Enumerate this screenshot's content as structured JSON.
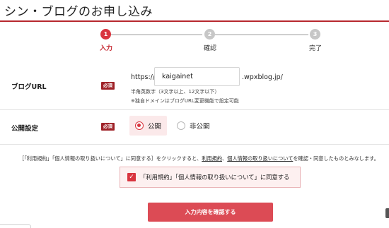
{
  "page": {
    "title": "シン・ブログのお申し込み"
  },
  "steps": [
    {
      "number": "1",
      "label": "入力",
      "active": true
    },
    {
      "number": "2",
      "label": "確認",
      "active": false
    },
    {
      "number": "3",
      "label": "完了",
      "active": false
    }
  ],
  "form": {
    "blog_url": {
      "label": "ブログURL",
      "required": "必須",
      "prefix": "https://",
      "value": "kaigainet",
      "suffix": ".wpxblog.jp/",
      "hint": "半角英数字（3文字以上、12文字以下）",
      "note": "※独自ドメインはブログURL変更機能で設定可能"
    },
    "visibility": {
      "label": "公開設定",
      "required": "必須",
      "options": [
        {
          "label": "公開",
          "selected": true
        },
        {
          "label": "非公開",
          "selected": false
        }
      ]
    }
  },
  "agreement": {
    "text_before": "［「利用規約」「個人情報の取り扱いについて」に同意する］をクリックすると、",
    "link_terms": "利用規約",
    "sep": "、",
    "link_privacy": "個人情報の取り扱いについて",
    "text_after": "を確認・同意したものとみなします。",
    "checkbox_label": "「利用規約」「個人情報の取り扱いについて」に同意する",
    "checked": true
  },
  "submit": {
    "label": "入力内容を確認する"
  },
  "colors": {
    "accent": "#d9353f",
    "badge": "#9e2127",
    "rule": "#b7282e"
  }
}
